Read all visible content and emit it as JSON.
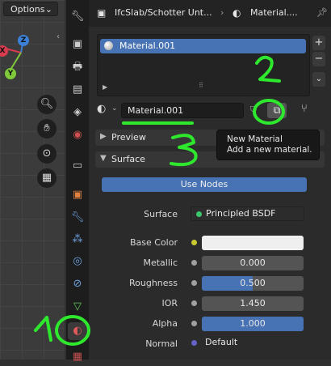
{
  "viewport": {
    "options_label": "Options",
    "gizmo": {
      "z": "Z",
      "y": "Y",
      "x": "X"
    }
  },
  "header": {
    "object_name": "IfcSlab/Schotter Unt...",
    "material_name": "Material...."
  },
  "slots": {
    "items": [
      {
        "label": "Material.001"
      }
    ]
  },
  "material": {
    "name": "Material.001"
  },
  "tooltip": {
    "title": "New Material",
    "description": "Add a new material."
  },
  "sections": {
    "preview": "Preview",
    "surface": "Surface"
  },
  "surface": {
    "use_nodes_label": "Use Nodes",
    "surface_label": "Surface",
    "surface_value": "Principled BSDF",
    "properties": [
      {
        "label": "Base Color",
        "value": "",
        "fill": 1.0
      },
      {
        "label": "Metallic",
        "value": "0.000",
        "fill": 0.0
      },
      {
        "label": "Roughness",
        "value": "0.500",
        "fill": 0.5
      },
      {
        "label": "IOR",
        "value": "1.450",
        "fill": 0.0
      },
      {
        "label": "Alpha",
        "value": "1.000",
        "fill": 1.0
      }
    ],
    "normal_label": "Normal",
    "normal_value": "Default"
  },
  "annotations": {
    "one": "1",
    "two": "2",
    "three": "3"
  },
  "colors": {
    "accent": "#4772b3",
    "annotation": "#2ee82e",
    "socket_yellow": "#c8c830",
    "socket_green": "#3cc86a",
    "socket_gray": "#a0a0a0",
    "socket_purple": "#6363c7"
  }
}
